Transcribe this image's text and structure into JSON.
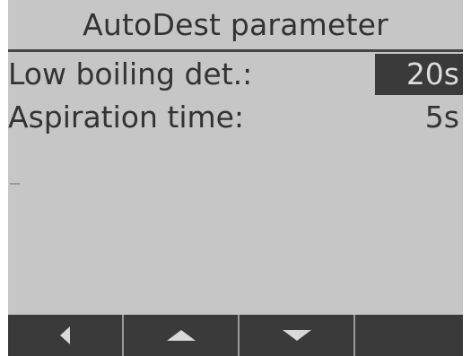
{
  "screen": {
    "title": "AutoDest parameter"
  },
  "parameters": [
    {
      "label": "Low boiling det.:",
      "value": "20s",
      "selected": true
    },
    {
      "label": "Aspiration time:",
      "value": "5s",
      "selected": false
    }
  ],
  "softkeys": [
    {
      "icon": "triangle-left-icon"
    },
    {
      "icon": "triangle-up-icon"
    },
    {
      "icon": "triangle-down-icon"
    },
    {
      "icon": ""
    }
  ],
  "colors": {
    "lcd_background": "#c6c6c6",
    "text": "#333333",
    "highlight_background": "#3a3a3a",
    "softkey_bar": "#3a3a3a",
    "softkey_icon": "#d8d8d8"
  }
}
